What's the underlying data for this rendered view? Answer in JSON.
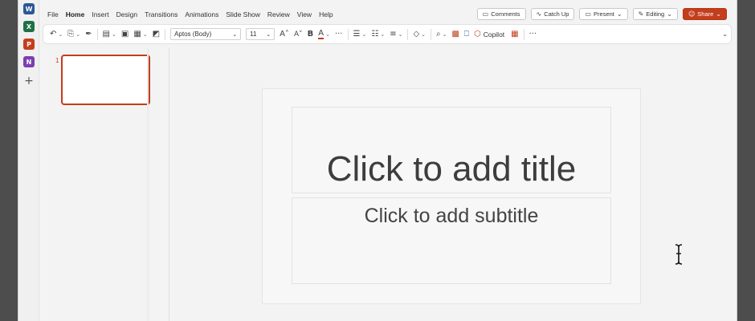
{
  "app": {
    "rail_apps": [
      {
        "name": "Word",
        "letter": "W",
        "color": "#2b5797"
      },
      {
        "name": "Excel",
        "letter": "X",
        "color": "#1e7145"
      },
      {
        "name": "PowerPoint",
        "letter": "P",
        "color": "#c43e1c"
      },
      {
        "name": "OneNote",
        "letter": "N",
        "color": "#7b3fb0"
      }
    ],
    "add_glyph": "+"
  },
  "menu": {
    "tabs": [
      "File",
      "Home",
      "Insert",
      "Design",
      "Transitions",
      "Animations",
      "Slide Show",
      "Review",
      "View",
      "Help"
    ],
    "active_tab": "Home"
  },
  "header_buttons": {
    "comments": "Comments",
    "catch_up": "Catch Up",
    "present": "Present",
    "editing": "Editing",
    "share": "Share"
  },
  "toolbar": {
    "font_name": "Aptos (Body)",
    "font_size": "11",
    "copilot": "Copilot",
    "more": "···"
  },
  "thumbnails": {
    "slide_number": "1"
  },
  "slide": {
    "title_placeholder": "Click to add title",
    "subtitle_placeholder": "Click to add subtitle"
  },
  "colors": {
    "accent": "#c43e1c",
    "background": "#f3f3f3"
  }
}
